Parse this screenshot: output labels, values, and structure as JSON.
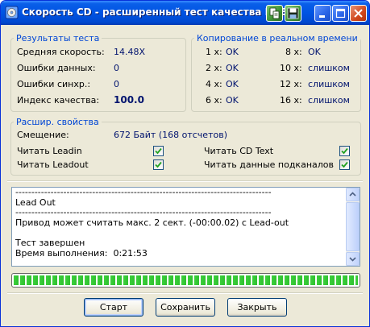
{
  "window": {
    "title": "Скорость CD - расширенный тест качества DAE",
    "accent_color": "#0054e3"
  },
  "results": {
    "legend": "Результаты теста",
    "rows": [
      {
        "label": "Средняя скорость:",
        "value": "14.48X"
      },
      {
        "label": "Ошибки данных:",
        "value": "0"
      },
      {
        "label": "Ошибки синхр.:",
        "value": "0"
      },
      {
        "label": "Индекс качества:",
        "value": "100.0"
      }
    ]
  },
  "realtime_copy": {
    "legend": "Копирование в реальном времени",
    "left": [
      {
        "speed": "1 x:",
        "result": "OK"
      },
      {
        "speed": "2 x:",
        "result": "OK"
      },
      {
        "speed": "4 x:",
        "result": "OK"
      },
      {
        "speed": "6 x:",
        "result": "OK"
      }
    ],
    "right": [
      {
        "speed": "8 x:",
        "result": "OK"
      },
      {
        "speed": "10 x:",
        "result": "слишком"
      },
      {
        "speed": "12 x:",
        "result": "слишком"
      },
      {
        "speed": "16 x:",
        "result": "слишком"
      }
    ]
  },
  "properties": {
    "legend": "Расшир. свойства",
    "offset_label": "Смещение:",
    "offset_value": "672 Байт (168 отсчетов)",
    "read_leadin": {
      "label": "Читать Leadin",
      "checked": true
    },
    "read_leadout": {
      "label": "Читать Leadout",
      "checked": true
    },
    "read_cdtext": {
      "label": "Читать CD Text",
      "checked": true
    },
    "read_subchannels": {
      "label": "Читать данные подканалов",
      "checked": true
    }
  },
  "log": {
    "lines": [
      "--------------------------------------------------------------------------------",
      "Lead Out",
      "--------------------------------------------------------------------------------",
      "Привод может считать макс. 2 сект. (-00:00.02) с Lead-out",
      "",
      "Тест завершен",
      "Время выполнения:  0:21:53"
    ]
  },
  "progress": {
    "fraction": 1.0
  },
  "buttons": {
    "start": "Старт",
    "save": "Сохранить",
    "close": "Закрыть"
  },
  "icons": {
    "app": "cd-speed-app-icon",
    "copy": "copy-icon",
    "save": "floppy-save-icon",
    "minimize": "minimize-icon",
    "maximize": "maximize-icon",
    "close": "close-icon",
    "scroll_up": "scroll-up-icon",
    "scroll_down": "scroll-down-icon"
  }
}
